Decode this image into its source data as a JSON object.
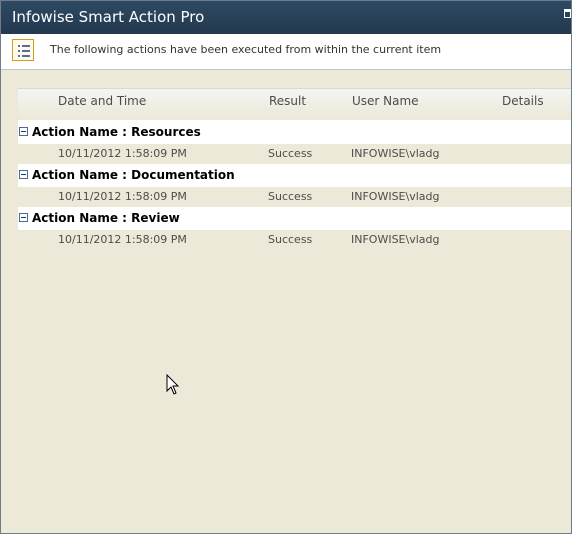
{
  "window": {
    "title": "Infowise Smart Action Pro"
  },
  "info_bar": {
    "icon": "list-icon",
    "text": "The following actions have been executed from within the current item"
  },
  "table": {
    "columns": [
      "Date and Time",
      "Result",
      "User Name",
      "Details"
    ],
    "groups": [
      {
        "label": "Action Name : Resources",
        "rows": [
          {
            "date_time": "10/11/2012 1:58:09 PM",
            "result": "Success",
            "user_name": "INFOWISE\\vladg",
            "details": ""
          }
        ]
      },
      {
        "label": "Action Name : Documentation",
        "rows": [
          {
            "date_time": "10/11/2012 1:58:09 PM",
            "result": "Success",
            "user_name": "INFOWISE\\vladg",
            "details": ""
          }
        ]
      },
      {
        "label": "Action Name : Review",
        "rows": [
          {
            "date_time": "10/11/2012 1:58:09 PM",
            "result": "Success",
            "user_name": "INFOWISE\\vladg",
            "details": ""
          }
        ]
      }
    ]
  }
}
